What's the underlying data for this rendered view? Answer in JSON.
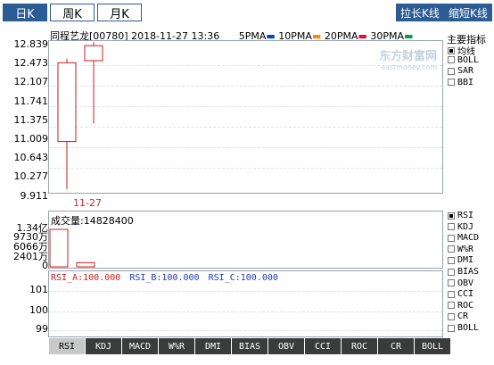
{
  "period_tabs": [
    {
      "label": "日K",
      "active": true
    },
    {
      "label": "周K",
      "active": false
    },
    {
      "label": "月K",
      "active": false
    }
  ],
  "buttons": {
    "stretch": "拉长K线",
    "shrink": "缩短K线"
  },
  "header": {
    "stock": "同程艺龙[00780]",
    "date": "2018-11-27",
    "time": "13:36",
    "ma": [
      {
        "label": "5PMA",
        "color": "#0044cc"
      },
      {
        "label": "10PMA",
        "color": "#ff8800"
      },
      {
        "label": "20PMA",
        "color": "#dd1133"
      },
      {
        "label": "30PMA",
        "color": "#119944"
      }
    ]
  },
  "watermark": {
    "name": "东方财富网",
    "url": "eastmoney.com"
  },
  "main_indicators": {
    "title": "主要指标",
    "items": [
      {
        "label": "均线",
        "checked": true
      },
      {
        "label": "BOLL",
        "checked": false
      },
      {
        "label": "SAR",
        "checked": false
      },
      {
        "label": "BBI",
        "checked": false
      }
    ]
  },
  "sub_indicators": [
    {
      "label": "RSI",
      "checked": true
    },
    {
      "label": "KDJ",
      "checked": false
    },
    {
      "label": "MACD",
      "checked": false
    },
    {
      "label": "W%R",
      "checked": false
    },
    {
      "label": "DMI",
      "checked": false
    },
    {
      "label": "BIAS",
      "checked": false
    },
    {
      "label": "OBV",
      "checked": false
    },
    {
      "label": "CCI",
      "checked": false
    },
    {
      "label": "ROC",
      "checked": false
    },
    {
      "label": "CR",
      "checked": false
    },
    {
      "label": "BOLL",
      "checked": false
    }
  ],
  "volume": {
    "label": "成交量:14828400",
    "yticks": [
      "1.34亿",
      "9730万",
      "6066万",
      "2401万",
      "0"
    ]
  },
  "rsi": {
    "a": "RSI_A:100.000",
    "b": "RSI_B:100.000",
    "c": "RSI_C:100.000",
    "yticks": [
      "101",
      "100",
      "99"
    ]
  },
  "bottom_tabs": [
    {
      "label": "RSI",
      "active": true
    },
    {
      "label": "KDJ",
      "active": false
    },
    {
      "label": "MACD",
      "active": false
    },
    {
      "label": "W%R",
      "active": false
    },
    {
      "label": "DMI",
      "active": false
    },
    {
      "label": "BIAS",
      "active": false
    },
    {
      "label": "OBV",
      "active": false
    },
    {
      "label": "CCI",
      "active": false
    },
    {
      "label": "ROC",
      "active": false
    },
    {
      "label": "CR",
      "active": false
    },
    {
      "label": "BOLL",
      "active": false
    }
  ],
  "chart_data": {
    "type": "candlestick",
    "price_yticks": [
      "12.839",
      "12.473",
      "12.107",
      "11.741",
      "11.375",
      "11.009",
      "10.643",
      "10.277",
      "9.911"
    ],
    "ylim": [
      9.911,
      12.839
    ],
    "xlabel_date": "11-27",
    "candles": [
      {
        "open": 10.9,
        "close": 12.42,
        "high": 12.5,
        "low": 9.98,
        "volume": 134000000
      },
      {
        "open": 12.46,
        "close": 12.75,
        "high": 12.82,
        "low": 11.25,
        "volume": 14828400
      }
    ],
    "volume_ylim": [
      0,
      134000000
    ]
  }
}
